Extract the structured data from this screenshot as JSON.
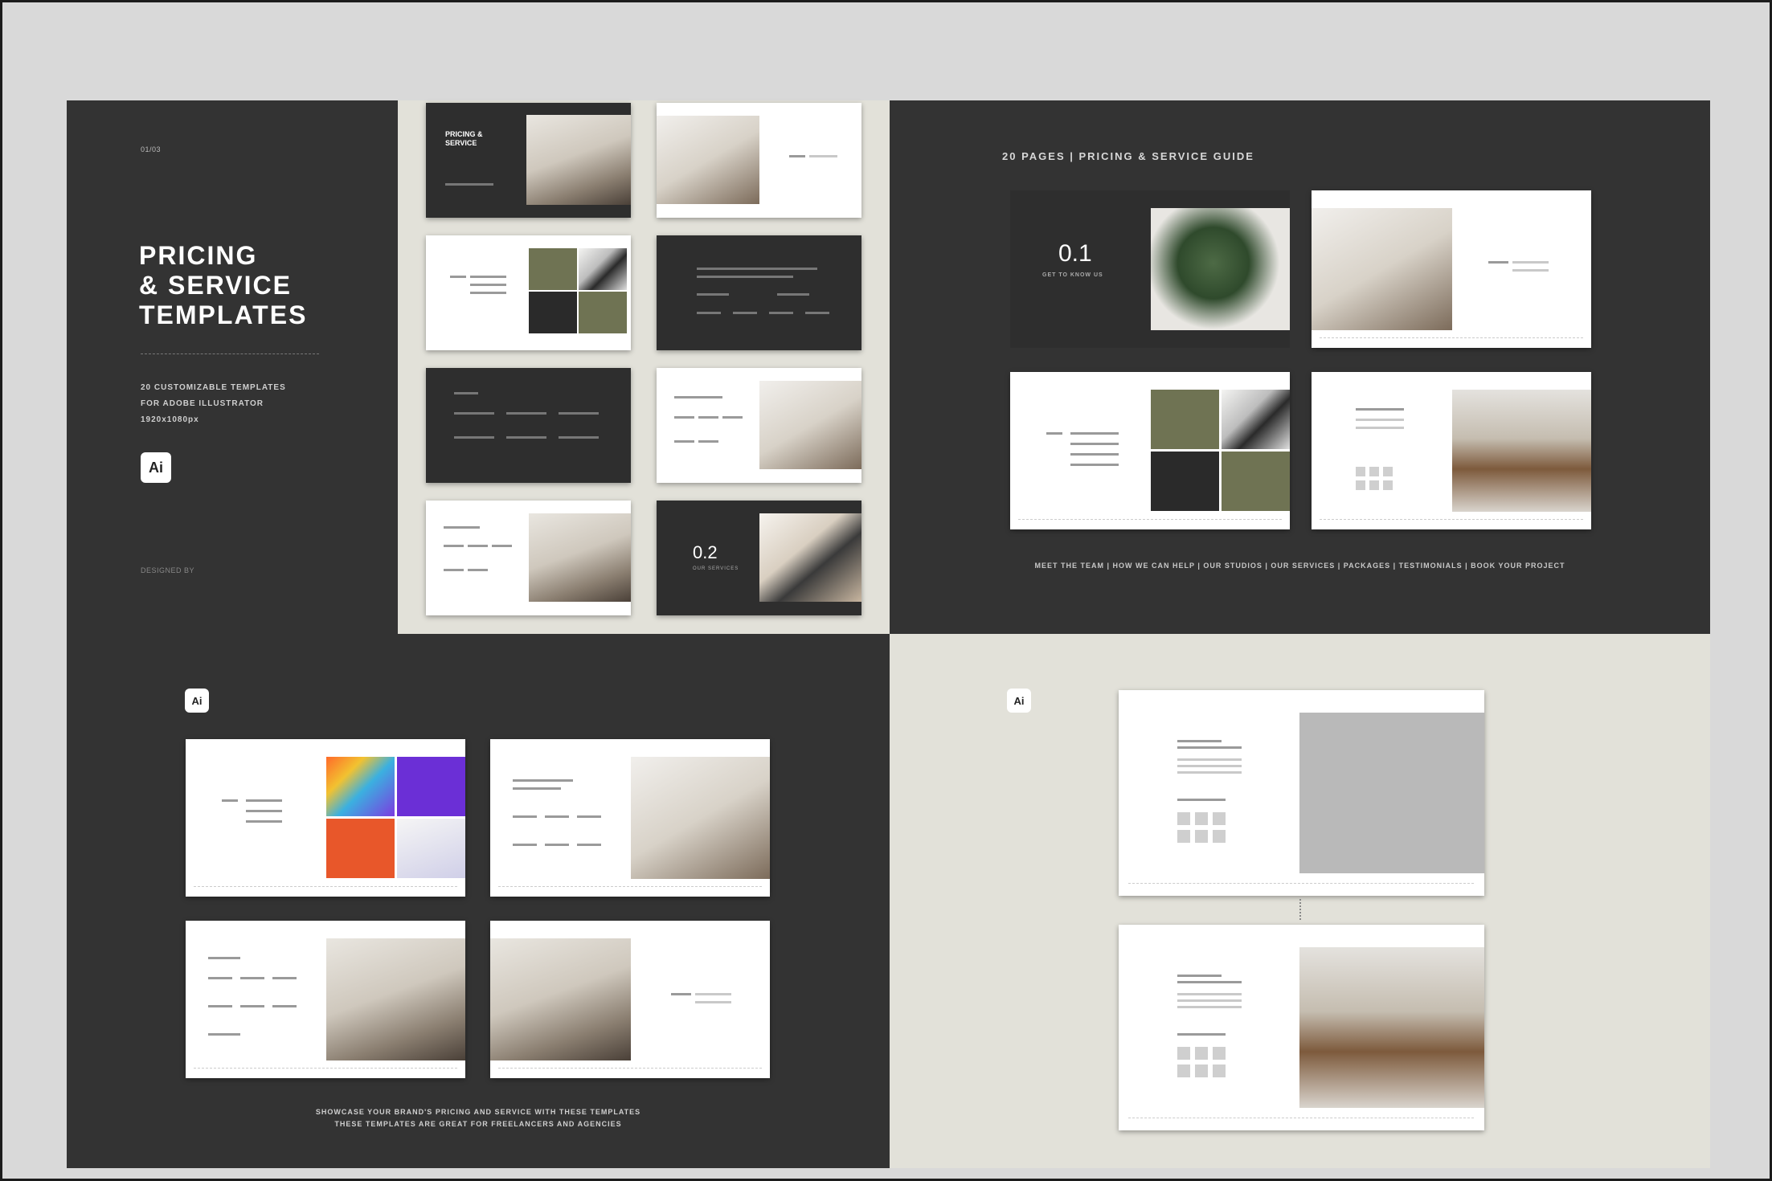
{
  "cover": {
    "edition": "01/03",
    "title_line1": "PRICING",
    "title_line2": "& SERVICE",
    "title_line3": "TEMPLATES",
    "subtitle_line1": "20 CUSTOMIZABLE TEMPLATES",
    "subtitle_line2": "FOR ADOBE ILLUSTRATOR",
    "subtitle_line3": "1920x1080px",
    "app_badge": "Ai",
    "footer": "DESIGNED BY"
  },
  "thumbs": {
    "slide1_title": "PRICING & SERVICE",
    "slide8_number": "0.2",
    "slide8_caption": "OUR SERVICES"
  },
  "guide": {
    "heading": "20 PAGES | PRICING & SERVICE GUIDE",
    "section_number": "0.1",
    "section_caption": "GET TO KNOW US",
    "nav": "MEET THE TEAM | HOW WE CAN HELP | OUR STUDIOS | OUR SERVICES | PACKAGES | TESTIMONIALS | BOOK YOUR PROJECT"
  },
  "bottom_left": {
    "app_badge": "Ai",
    "caption_line1": "SHOWCASE YOUR BRAND'S PRICING AND SERVICE WITH THESE TEMPLATES",
    "caption_line2": "THESE TEMPLATES ARE GREAT FOR FREELANCERS AND AGENCIES"
  },
  "bottom_right": {
    "app_badge": "Ai"
  }
}
